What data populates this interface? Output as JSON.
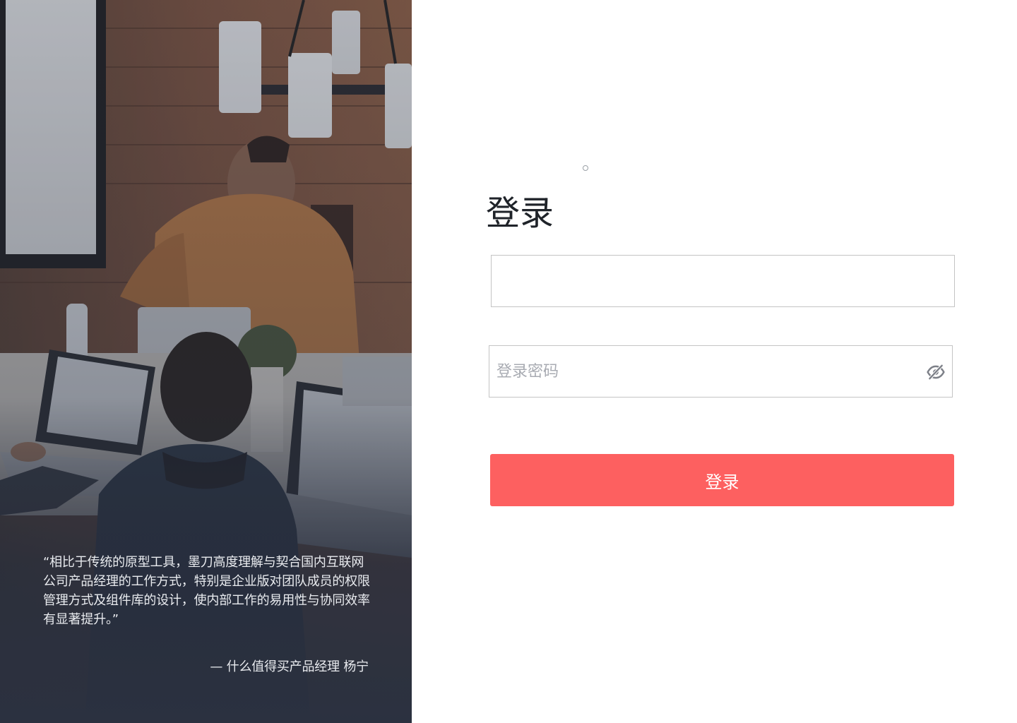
{
  "hero": {
    "quote": "“相比于传统的原型工具，墨刀高度理解与契合国内互联网公司产品经理的工作方式，特别是企业版对团队成员的权限管理方式及组件库的设计，使内部工作的易用性与协同效率有显著提升。”",
    "author": "— 什么值得买产品经理 杨宁",
    "photo_icon": "office-team-photo"
  },
  "login": {
    "title": "登录",
    "username": {
      "value": "",
      "placeholder": ""
    },
    "password": {
      "value": "",
      "placeholder": "登录密码",
      "toggle_icon": "eye-slash-icon"
    },
    "submit_label": "登录"
  },
  "colors": {
    "accent": "#fd6060",
    "hero_overlay": "#2b3140",
    "input_border": "#c4c4c4",
    "title": "#1f2329"
  }
}
